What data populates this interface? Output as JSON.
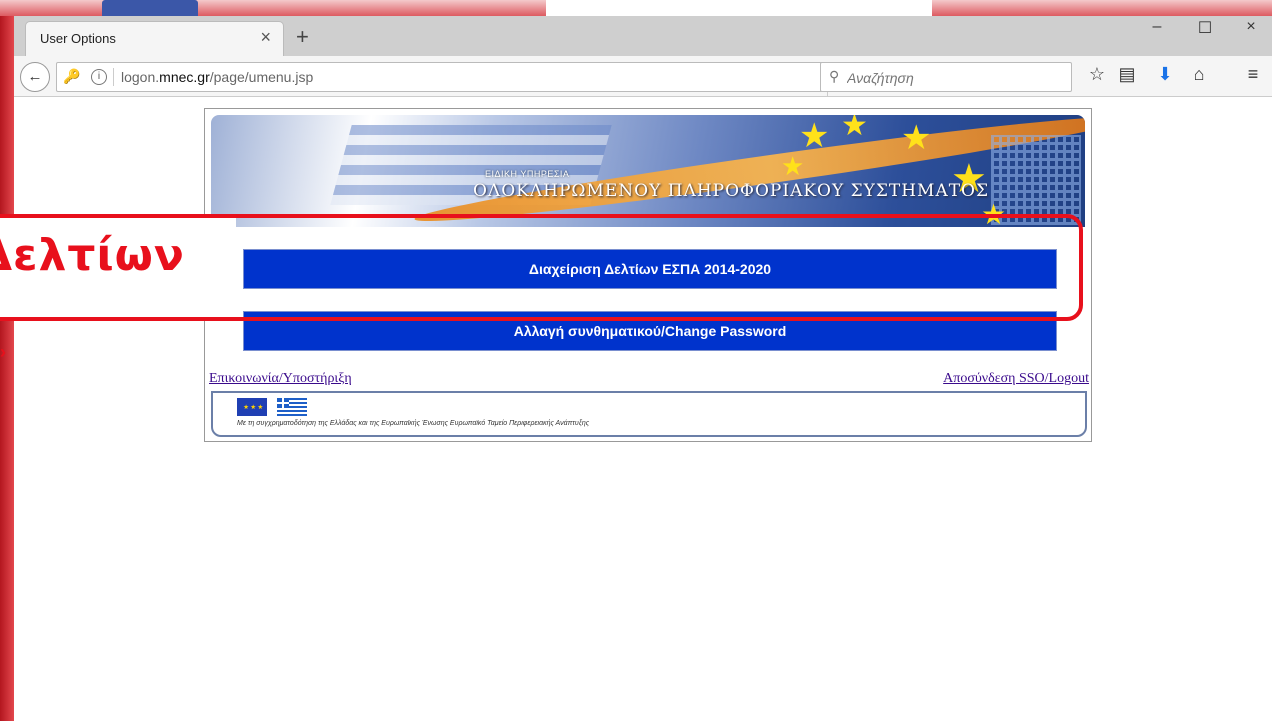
{
  "browser": {
    "tab_title": "User Options",
    "tab_close": "×",
    "new_tab": "+",
    "window_controls": {
      "minimize": "–",
      "maximize": "☐",
      "close": "×"
    },
    "back_glyph": "←",
    "url_host_plain": "logon.",
    "url_host_bold": "mnec.gr",
    "url_path": "/page/umenu.jsp",
    "reload_glyph": "C",
    "search_placeholder": "Αναζήτηση",
    "toolbar_icons": [
      "bookmark-star-icon",
      "reading-list-icon",
      "download-icon",
      "home-icon",
      "menu-icon"
    ]
  },
  "page": {
    "banner": {
      "subtitle": "ΕΙΔΙΚΗ ΥΠΗΡΕΣΙΑ",
      "title": "ΟΛΟΚΛΗΡΩΜΕΝΟΥ ΠΛΗΡΟΦΟΡΙΑΚΟΥ ΣΥΣΤΗΜΑΤΟΣ"
    },
    "menu": [
      {
        "label": "Διαχείριση Δελτίων ΕΣΠΑ 2014-2020"
      },
      {
        "label": "Αλλαγή συνθηματικού/Change Password"
      }
    ],
    "footer": {
      "left_link": "Επικοινωνία/Υποστήριξη",
      "right_link": "Αποσύνδεση SSO/Logout",
      "caption": "Με τη συγχρηματοδότηση της Ελλάδας και της Ευρωπαϊκής Ένωσης Ευρωπαϊκό Ταμείο Περιφερειακής Ανάπτυξης"
    }
  },
  "overlay": {
    "callout_word": "Δελτίων",
    "chevron": "›",
    "accent_color": "#e8101c"
  }
}
